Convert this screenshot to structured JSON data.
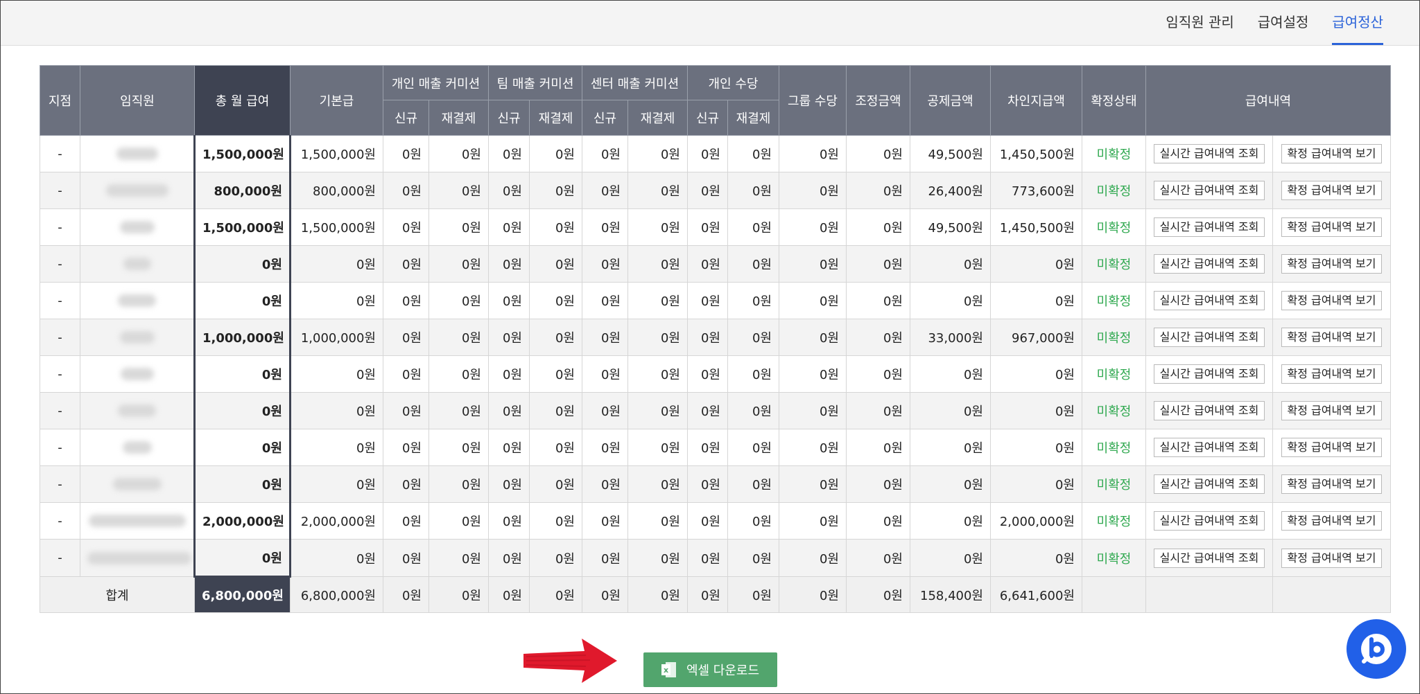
{
  "nav": {
    "tabs": [
      {
        "label": "임직원 관리"
      },
      {
        "label": "급여설정"
      },
      {
        "label": "급여정산"
      }
    ]
  },
  "table": {
    "headers": {
      "branch": "지점",
      "employee": "임직원",
      "total_monthly": "총 월 급여",
      "base_pay": "기본급",
      "personal_sales": "개인 매출 커미션",
      "team_sales": "팀 매출 커미션",
      "center_sales": "센터 매출 커미션",
      "personal_allowance": "개인 수당",
      "new": "신규",
      "repay": "재결제",
      "group_allowance": "그룹 수당",
      "adjustment": "조정금액",
      "deduction": "공제금액",
      "net_pay": "차인지급액",
      "status": "확정상태",
      "pay_detail": "급여내역"
    },
    "buttons": {
      "realtime": "실시간 급여내역 조회",
      "confirmed": "확정 급여내역 보기"
    },
    "rows": [
      {
        "branch": "-",
        "total": "1,500,000원",
        "base": "1,500,000원",
        "c1": "0원",
        "c2": "0원",
        "c3": "0원",
        "c4": "0원",
        "c5": "0원",
        "c6": "0원",
        "c7": "0원",
        "c8": "0원",
        "group": "0원",
        "adjust": "0원",
        "deduct": "49,500원",
        "net": "1,450,500원",
        "status": "미확정"
      },
      {
        "branch": "-",
        "total": "800,000원",
        "base": "800,000원",
        "c1": "0원",
        "c2": "0원",
        "c3": "0원",
        "c4": "0원",
        "c5": "0원",
        "c6": "0원",
        "c7": "0원",
        "c8": "0원",
        "group": "0원",
        "adjust": "0원",
        "deduct": "26,400원",
        "net": "773,600원",
        "status": "미확정"
      },
      {
        "branch": "-",
        "total": "1,500,000원",
        "base": "1,500,000원",
        "c1": "0원",
        "c2": "0원",
        "c3": "0원",
        "c4": "0원",
        "c5": "0원",
        "c6": "0원",
        "c7": "0원",
        "c8": "0원",
        "group": "0원",
        "adjust": "0원",
        "deduct": "49,500원",
        "net": "1,450,500원",
        "status": "미확정"
      },
      {
        "branch": "-",
        "total": "0원",
        "base": "0원",
        "c1": "0원",
        "c2": "0원",
        "c3": "0원",
        "c4": "0원",
        "c5": "0원",
        "c6": "0원",
        "c7": "0원",
        "c8": "0원",
        "group": "0원",
        "adjust": "0원",
        "deduct": "0원",
        "net": "0원",
        "status": "미확정"
      },
      {
        "branch": "-",
        "total": "0원",
        "base": "0원",
        "c1": "0원",
        "c2": "0원",
        "c3": "0원",
        "c4": "0원",
        "c5": "0원",
        "c6": "0원",
        "c7": "0원",
        "c8": "0원",
        "group": "0원",
        "adjust": "0원",
        "deduct": "0원",
        "net": "0원",
        "status": "미확정"
      },
      {
        "branch": "-",
        "total": "1,000,000원",
        "base": "1,000,000원",
        "c1": "0원",
        "c2": "0원",
        "c3": "0원",
        "c4": "0원",
        "c5": "0원",
        "c6": "0원",
        "c7": "0원",
        "c8": "0원",
        "group": "0원",
        "adjust": "0원",
        "deduct": "33,000원",
        "net": "967,000원",
        "status": "미확정"
      },
      {
        "branch": "-",
        "total": "0원",
        "base": "0원",
        "c1": "0원",
        "c2": "0원",
        "c3": "0원",
        "c4": "0원",
        "c5": "0원",
        "c6": "0원",
        "c7": "0원",
        "c8": "0원",
        "group": "0원",
        "adjust": "0원",
        "deduct": "0원",
        "net": "0원",
        "status": "미확정"
      },
      {
        "branch": "-",
        "total": "0원",
        "base": "0원",
        "c1": "0원",
        "c2": "0원",
        "c3": "0원",
        "c4": "0원",
        "c5": "0원",
        "c6": "0원",
        "c7": "0원",
        "c8": "0원",
        "group": "0원",
        "adjust": "0원",
        "deduct": "0원",
        "net": "0원",
        "status": "미확정"
      },
      {
        "branch": "-",
        "total": "0원",
        "base": "0원",
        "c1": "0원",
        "c2": "0원",
        "c3": "0원",
        "c4": "0원",
        "c5": "0원",
        "c6": "0원",
        "c7": "0원",
        "c8": "0원",
        "group": "0원",
        "adjust": "0원",
        "deduct": "0원",
        "net": "0원",
        "status": "미확정"
      },
      {
        "branch": "-",
        "total": "0원",
        "base": "0원",
        "c1": "0원",
        "c2": "0원",
        "c3": "0원",
        "c4": "0원",
        "c5": "0원",
        "c6": "0원",
        "c7": "0원",
        "c8": "0원",
        "group": "0원",
        "adjust": "0원",
        "deduct": "0원",
        "net": "0원",
        "status": "미확정"
      },
      {
        "branch": "-",
        "total": "2,000,000원",
        "base": "2,000,000원",
        "c1": "0원",
        "c2": "0원",
        "c3": "0원",
        "c4": "0원",
        "c5": "0원",
        "c6": "0원",
        "c7": "0원",
        "c8": "0원",
        "group": "0원",
        "adjust": "0원",
        "deduct": "0원",
        "net": "2,000,000원",
        "status": "미확정"
      },
      {
        "branch": "-",
        "total": "0원",
        "base": "0원",
        "c1": "0원",
        "c2": "0원",
        "c3": "0원",
        "c4": "0원",
        "c5": "0원",
        "c6": "0원",
        "c7": "0원",
        "c8": "0원",
        "group": "0원",
        "adjust": "0원",
        "deduct": "0원",
        "net": "0원",
        "status": "미확정"
      }
    ],
    "footer": {
      "label": "합계",
      "total": "6,800,000원",
      "base": "6,800,000원",
      "c1": "0원",
      "c2": "0원",
      "c3": "0원",
      "c4": "0원",
      "c5": "0원",
      "c6": "0원",
      "c7": "0원",
      "c8": "0원",
      "group": "0원",
      "adjust": "0원",
      "deduct": "158,400원",
      "net": "6,641,600원"
    }
  },
  "actions": {
    "excel_download": "엑셀 다운로드"
  },
  "colors": {
    "accent": "#2b63d9",
    "header": "#6b707e",
    "header_dark": "#3e4352",
    "status_green": "#2fa84f",
    "excel_green": "#52a56d",
    "chat_blue": "#2160e8",
    "arrow_red": "#e0192c"
  },
  "icons": {
    "excel": "excel-icon",
    "chat": "chat-icon",
    "arrow": "red-arrow"
  }
}
